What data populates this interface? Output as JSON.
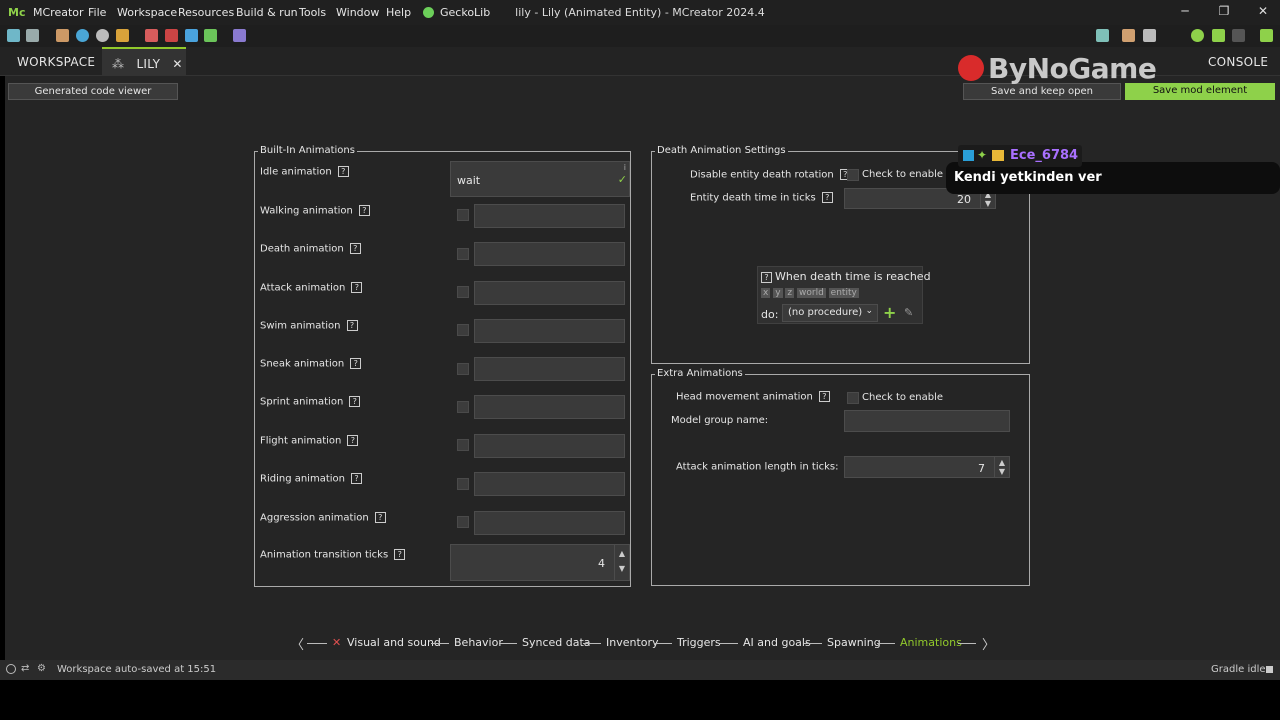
{
  "app": {
    "title": "lily - Lily (Animated Entity) - MCreator 2024.4",
    "logo": "Mc",
    "menu": [
      "MCreator",
      "File",
      "Workspace",
      "Resources",
      "Build & run",
      "Tools",
      "Window",
      "Help",
      "GeckoLib"
    ],
    "window_controls": {
      "minimize": "─",
      "maximize": "❐",
      "close": "✕"
    }
  },
  "tabs": {
    "workspace": "WORKSPACE",
    "lily": "LILY",
    "lily_close": "✕",
    "console": "CONSOLE"
  },
  "actions": {
    "generated_code": "Generated code viewer",
    "save_keep_open": "Save and keep open",
    "save_mod": "Save mod element"
  },
  "watermark": "ByNoGame",
  "builtin": {
    "legend": "Built-In Animations",
    "help": "?",
    "idle_label": "Idle animation",
    "idle_value": "wait",
    "idle_check": "✓",
    "idle_info": "i",
    "rows": [
      "Walking animation",
      "Death animation",
      "Attack animation",
      "Swim animation",
      "Sneak animation",
      "Sprint animation",
      "Flight animation",
      "Riding animation",
      "Aggression animation"
    ],
    "transition_label": "Animation transition ticks",
    "transition_value": "4"
  },
  "death": {
    "legend": "Death Animation Settings",
    "disable_rotation": "Disable entity death rotation",
    "check_to_enable": "Check to enable",
    "death_time_label": "Entity death time in ticks",
    "death_time_value": "20"
  },
  "procedure": {
    "title": "When death time is reached",
    "deps": [
      "x",
      "y",
      "z",
      "world",
      "entity"
    ],
    "do_label": "do:",
    "selected": "(no procedure)",
    "add": "+",
    "edit": "✎"
  },
  "extra": {
    "legend": "Extra Animations",
    "head_label": "Head movement animation",
    "check_to_enable": "Check to enable",
    "group_label": "Model group name:",
    "attack_len_label": "Attack animation length in ticks:",
    "attack_len_value": "7"
  },
  "overlay": {
    "user": "Ece_6784",
    "message": "Kendi yetkinden ver"
  },
  "nav": {
    "prev": "〈",
    "next": "〉",
    "error_mark": "✕",
    "items": [
      "Visual and sound",
      "Behavior",
      "Synced data",
      "Inventory",
      "Triggers",
      "AI and goals",
      "Spawning",
      "Animations"
    ]
  },
  "status": {
    "text": "Workspace auto-saved at 15:51",
    "gradle": "Gradle idle"
  },
  "colors": {
    "accent": "#91c92b",
    "save_btn": "#8ed14a",
    "overlay_name": "#a970ff"
  }
}
